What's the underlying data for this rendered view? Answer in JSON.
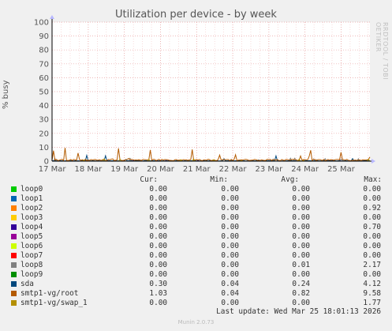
{
  "chart_data": {
    "type": "line",
    "title": "Utilization per device - by week",
    "ylabel": "% busy",
    "ylim": [
      0,
      100
    ],
    "y_ticks": [
      0,
      10,
      20,
      30,
      40,
      50,
      60,
      70,
      80,
      90,
      100
    ],
    "x_ticks": [
      "17 Mar",
      "18 Mar",
      "19 Mar",
      "20 Mar",
      "21 Mar",
      "22 Mar",
      "23 Mar",
      "24 Mar",
      "25 Mar"
    ],
    "grid": true,
    "legend_columns": [
      "Cur:",
      "Min:",
      "Avg:",
      "Max:"
    ],
    "series": [
      {
        "name": "loop0",
        "color": "#00cc00",
        "cur": "0.00",
        "min": "0.00",
        "avg": "0.00",
        "max": "0.00"
      },
      {
        "name": "loop1",
        "color": "#0066b3",
        "cur": "0.00",
        "min": "0.00",
        "avg": "0.00",
        "max": "0.00"
      },
      {
        "name": "loop2",
        "color": "#ff8000",
        "cur": "0.00",
        "min": "0.00",
        "avg": "0.00",
        "max": "0.92"
      },
      {
        "name": "loop3",
        "color": "#ffcc00",
        "cur": "0.00",
        "min": "0.00",
        "avg": "0.00",
        "max": "0.00"
      },
      {
        "name": "loop4",
        "color": "#330099",
        "cur": "0.00",
        "min": "0.00",
        "avg": "0.00",
        "max": "0.70"
      },
      {
        "name": "loop5",
        "color": "#990099",
        "cur": "0.00",
        "min": "0.00",
        "avg": "0.00",
        "max": "0.00"
      },
      {
        "name": "loop6",
        "color": "#ccff00",
        "cur": "0.00",
        "min": "0.00",
        "avg": "0.00",
        "max": "0.00"
      },
      {
        "name": "loop7",
        "color": "#ff0000",
        "cur": "0.00",
        "min": "0.00",
        "avg": "0.00",
        "max": "0.00"
      },
      {
        "name": "loop8",
        "color": "#808080",
        "cur": "0.00",
        "min": "0.00",
        "avg": "0.01",
        "max": "2.17"
      },
      {
        "name": "loop9",
        "color": "#008f00",
        "cur": "0.00",
        "min": "0.00",
        "avg": "0.00",
        "max": "0.00"
      },
      {
        "name": "sda",
        "color": "#00487d",
        "cur": "0.30",
        "min": "0.04",
        "avg": "0.24",
        "max": "4.12"
      },
      {
        "name": "smtp1-vg/root",
        "color": "#b35a00",
        "cur": "1.03",
        "min": "0.04",
        "avg": "0.82",
        "max": "9.58"
      },
      {
        "name": "smtp1-vg/swap_1",
        "color": "#b38f00",
        "cur": "0.00",
        "min": "0.00",
        "avg": "0.00",
        "max": "1.77"
      }
    ]
  },
  "watermark": "RRDTOOL / TOBI OETIKER",
  "last_update": "Last update: Wed Mar 25 18:01:13 2026",
  "footer": "Munin 2.0.73"
}
